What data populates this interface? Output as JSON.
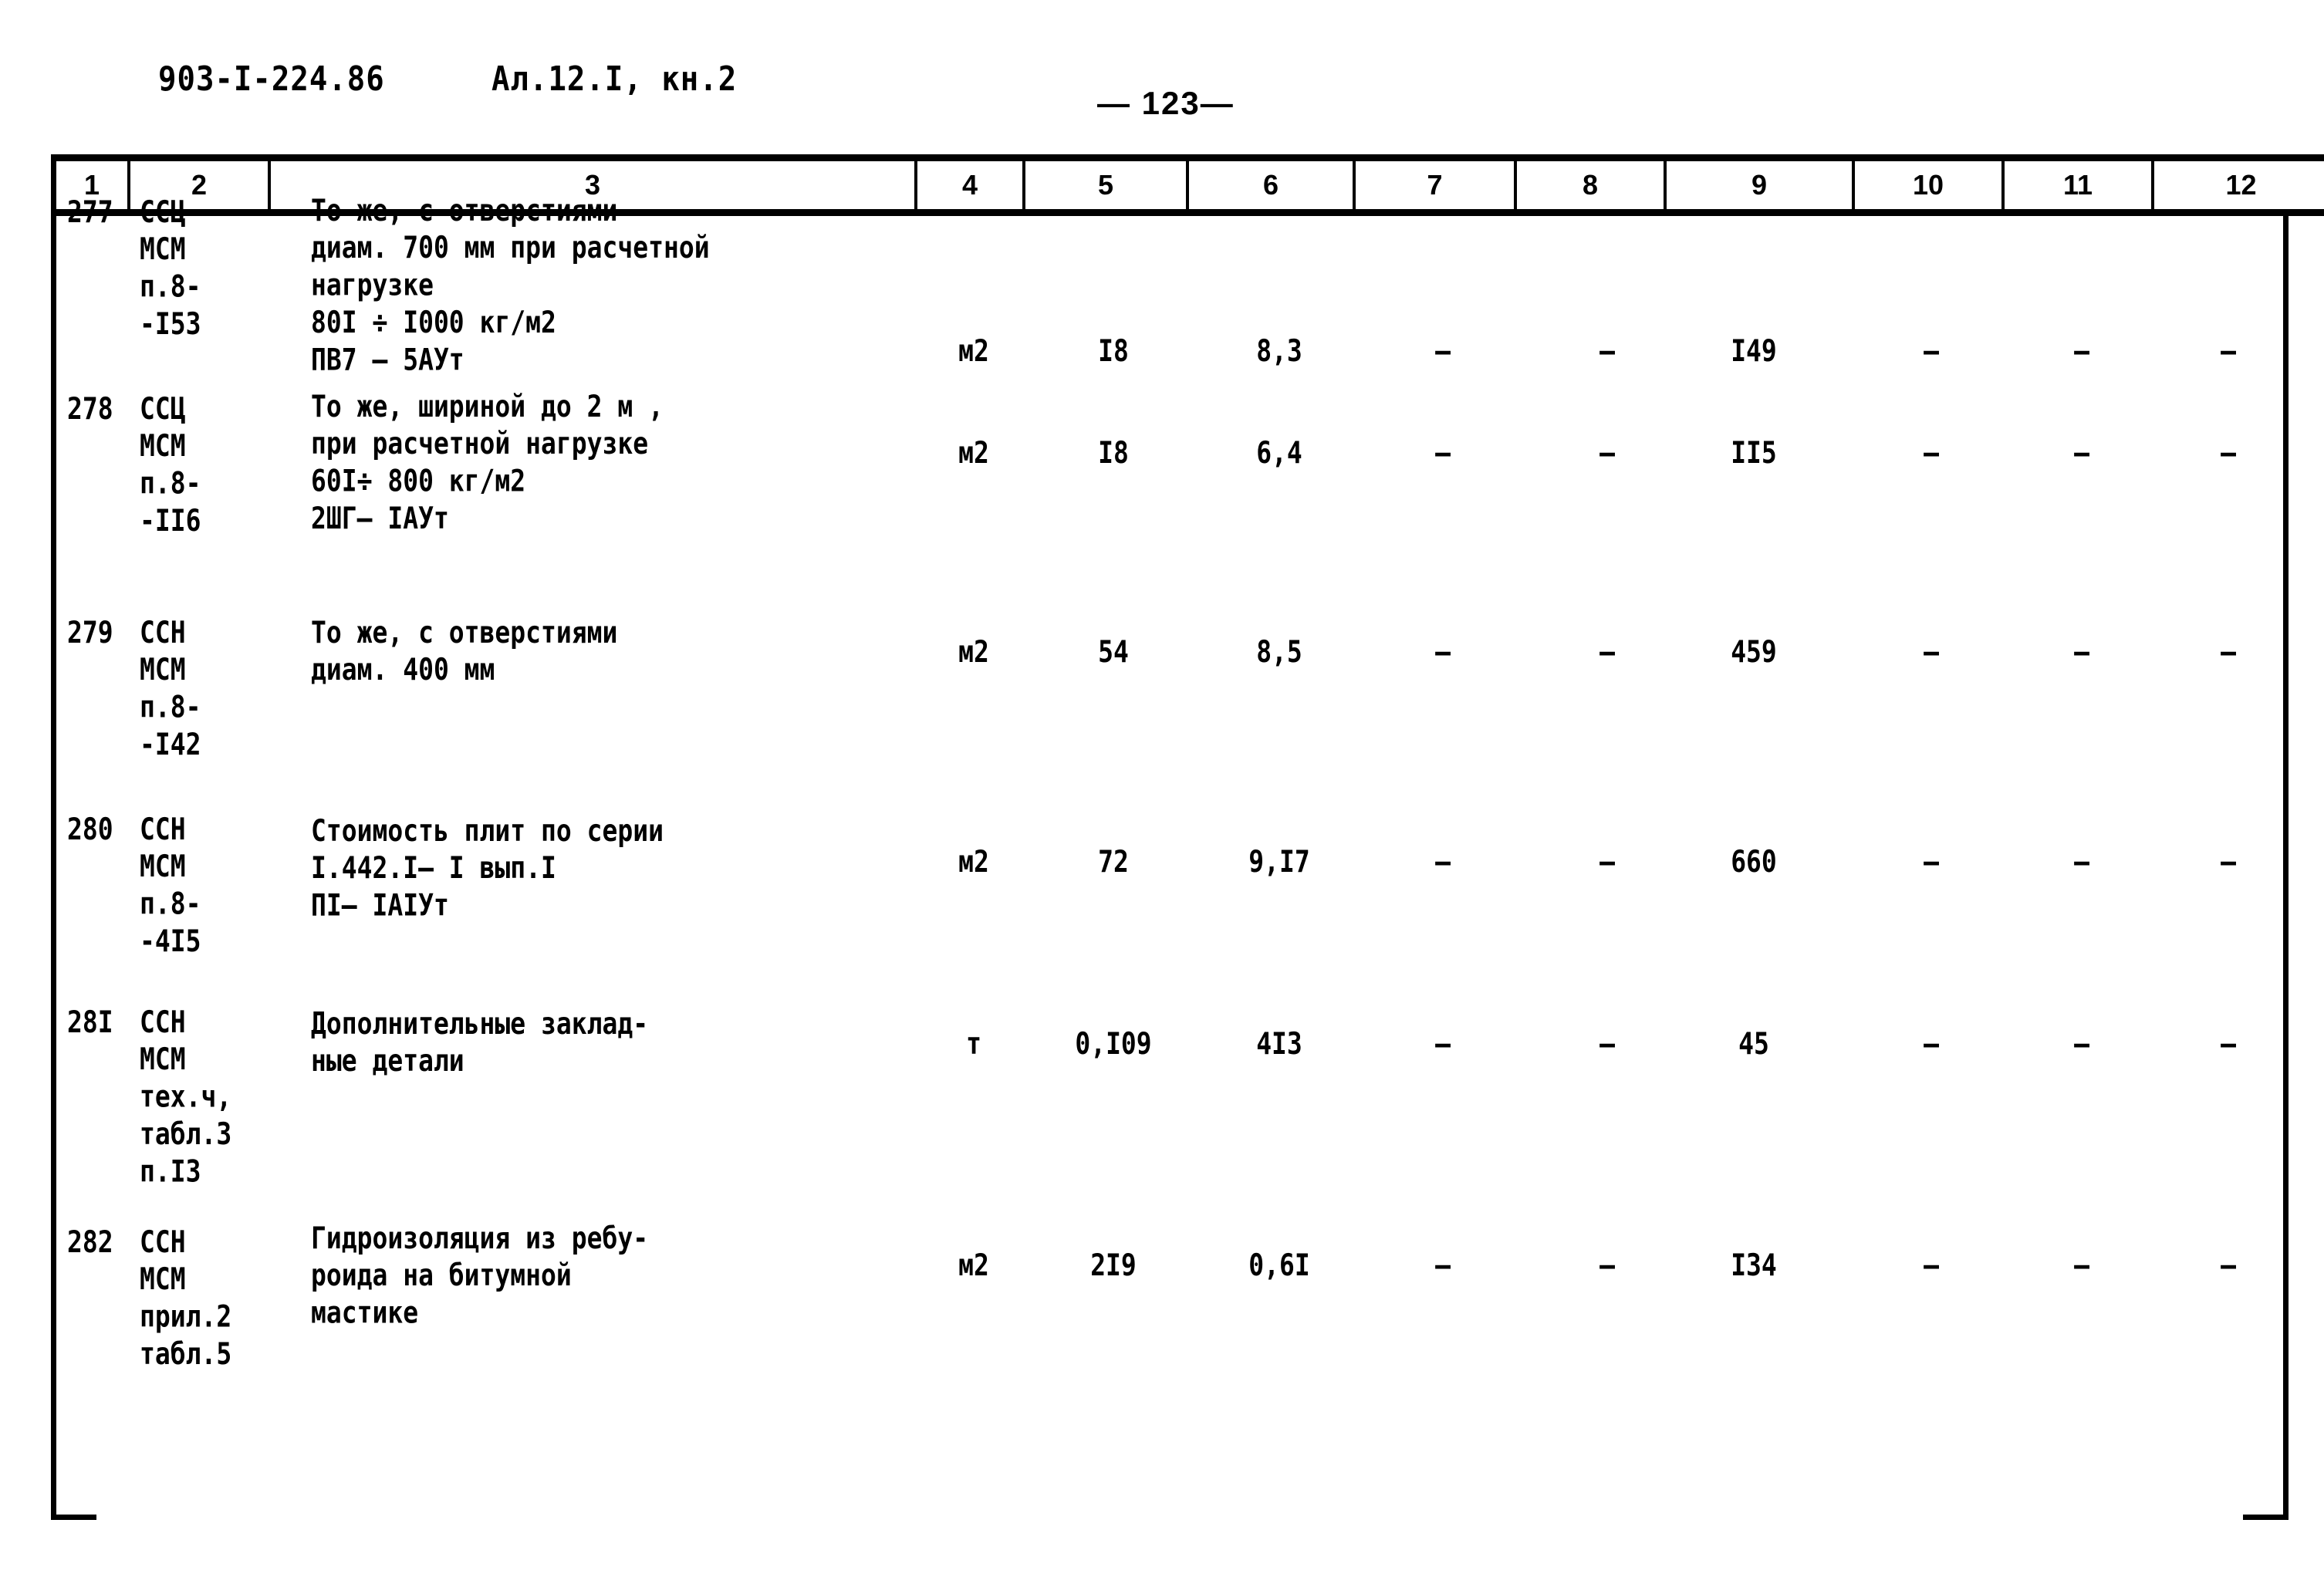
{
  "document": {
    "code": "903-I-224.86",
    "album": "Ал.12.I, кн.2",
    "page_number": "— 123—"
  },
  "table": {
    "column_headers": [
      "1",
      "2",
      "3",
      "4",
      "5",
      "6",
      "7",
      "8",
      "9",
      "10",
      "11",
      "12"
    ],
    "rows": [
      {
        "num": "277",
        "code": "ССЦ\nМСМ\nп.8-\n-I53",
        "desc": "То же, с отверстиями\nдиам. 700 мм при расчетной\nнагрузке\n80I ÷ I000 кг/м2\nПВ7 – 5АУт",
        "unit": "м2",
        "v5": "I8",
        "v6": "8,3",
        "v7": "–",
        "v8": "–",
        "v9": "I49",
        "v10": "–",
        "v11": "–",
        "v12": "–"
      },
      {
        "num": "278",
        "code": "ССЦ\nМСМ\nп.8-\n-II6",
        "desc": "То же, шириной до 2 м ,\nпри расчетной нагрузке\n60I÷ 800 кг/м2\n2ШГ– IАУт",
        "unit": "м2",
        "v5": "I8",
        "v6": "6,4",
        "v7": "–",
        "v8": "–",
        "v9": "II5",
        "v10": "–",
        "v11": "–",
        "v12": "–"
      },
      {
        "num": "279",
        "code": "ССН\nМСМ\nп.8-\n-I42",
        "desc": "То же, с отверстиями\nдиам. 400 мм",
        "unit": "м2",
        "v5": "54",
        "v6": "8,5",
        "v7": "–",
        "v8": "–",
        "v9": "459",
        "v10": "–",
        "v11": "–",
        "v12": "–"
      },
      {
        "num": "280",
        "code": "ССН\nМСМ\nп.8-\n-4I5",
        "desc": "Стоимость плит по серии\nI.442.I– I вып.I\nПI– IАIУт",
        "unit": "м2",
        "v5": "72",
        "v6": "9,I7",
        "v7": "–",
        "v8": "–",
        "v9": "660",
        "v10": "–",
        "v11": "–",
        "v12": "–"
      },
      {
        "num": "28I",
        "code": "ССН\nМСМ\nтех.ч,\nтабл.3\nп.I3",
        "desc": "Дополнительные заклад-\nные детали",
        "unit": "т",
        "v5": "0,I09",
        "v6": "4I3",
        "v7": "–",
        "v8": "–",
        "v9": "45",
        "v10": "–",
        "v11": "–",
        "v12": "—"
      },
      {
        "num": "282",
        "code": "ССН\nМСМ\nприл.2\nтабл.5",
        "desc": "Гидроизоляция из ребу-\nроида на битумной\nмастике",
        "unit": "м2",
        "v5": "2I9",
        "v6": "0,6I",
        "v7": "–",
        "v8": "–",
        "v9": "I34",
        "v10": "–",
        "v11": "–",
        "v12": "–"
      }
    ]
  }
}
